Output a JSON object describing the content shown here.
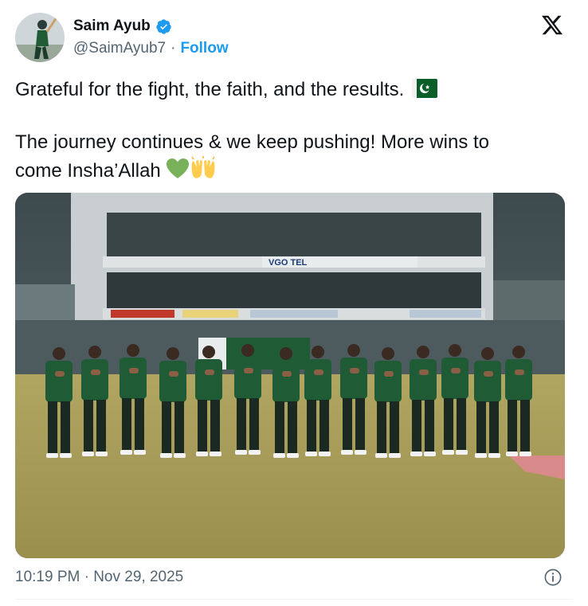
{
  "author": {
    "display_name": "Saim Ayub",
    "handle": "@SaimAyub7",
    "follow_label": "Follow",
    "separator": "·",
    "verified_color": "#1d9bf0"
  },
  "post": {
    "line1": "Grateful for the fight, the faith, and the results.",
    "line2": "The journey continues & we keep pushing! More wins to",
    "line3": "come Insha’Allah",
    "emoji_flag": "pakistan-flag-icon",
    "emoji_heart": "green-heart-icon",
    "emoji_hands": "raising-hands-icon"
  },
  "media": {
    "board_text": "VGO TEL",
    "image_subject": "team-lineup-photo"
  },
  "meta": {
    "timestamp": "10:19 PM · Nov 29, 2025"
  },
  "colors": {
    "text": "#0f1419",
    "secondary": "#536471",
    "accent": "#1d9bf0",
    "jersey": "#1f5b35"
  }
}
